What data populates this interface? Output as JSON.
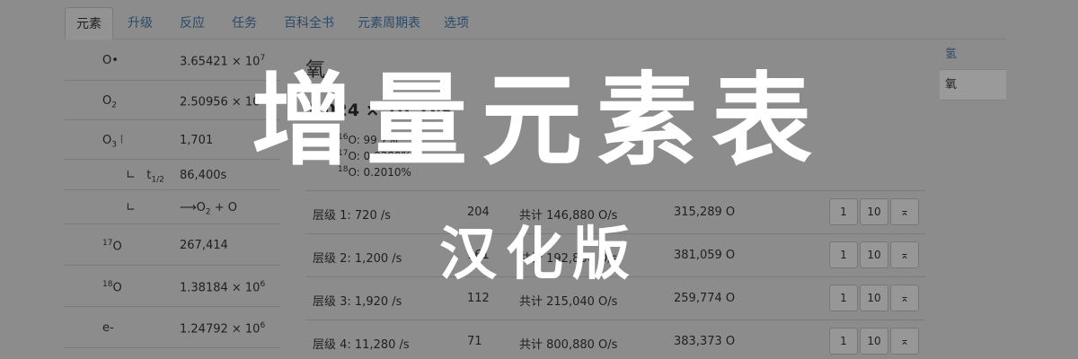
{
  "tabs": [
    "元素",
    "升级",
    "反应",
    "任务",
    "百科全书",
    "元素周期表",
    "选项"
  ],
  "left_rows": [
    {
      "name_html": "O•",
      "val_html": "3.65421 × 10<sup>7</sup>"
    },
    {
      "name_html": "O<sub>2</sub>",
      "val_html": "2.50956 × 10<sup>6</sup>"
    },
    {
      "name_html": "O<sub>3</sub> ⦚",
      "val_html": "1,701"
    },
    {
      "name_html": "∟ &nbsp; t<sub>1/2</sub>",
      "val_html": "86,400s"
    },
    {
      "name_html": "∟",
      "val_html": "⟶O<sub>2</sub> + O"
    },
    {
      "name_html": "<sup>17</sup>O",
      "val_html": "267,414"
    },
    {
      "name_html": "<sup>18</sup>O",
      "val_html": "1.38184 × 10<sup>6</sup>"
    },
    {
      "name_html": "e-",
      "val_html": "1.24792 × 10<sup>6</sup>"
    }
  ],
  "element": {
    "name": "氧",
    "amount_html": "1.024 × 10<sup>8</sup> O/s",
    "isotopes_html": [
      "<sup>16</sup>O: 99.7%",
      "<sup>17</sup>O: 0.0380%",
      "<sup>18</sup>O: 0.2010%"
    ]
  },
  "tiers": [
    {
      "label": "层级 1:  720 /s",
      "count": "204",
      "total": "共计 146,880 O/s",
      "cost": "315,289 O"
    },
    {
      "label": "层级 2:  1,200 /s",
      "count": "161",
      "total": "共计 192,800 O/s",
      "cost": "381,059 O"
    },
    {
      "label": "层级 3:  1,920 /s",
      "count": "112",
      "total": "共计 215,040 O/s",
      "cost": "259,774 O"
    },
    {
      "label": "层级 4:  11,280 /s",
      "count": "71",
      "total": "共计 800,880 O/s",
      "cost": "383,373 O"
    }
  ],
  "tier_buttons": {
    "one": "1",
    "ten": "10",
    "max": "⌅"
  },
  "right_list": [
    "氢",
    "氧"
  ],
  "banner": {
    "title": "增量元素表",
    "subtitle": "汉化版"
  }
}
